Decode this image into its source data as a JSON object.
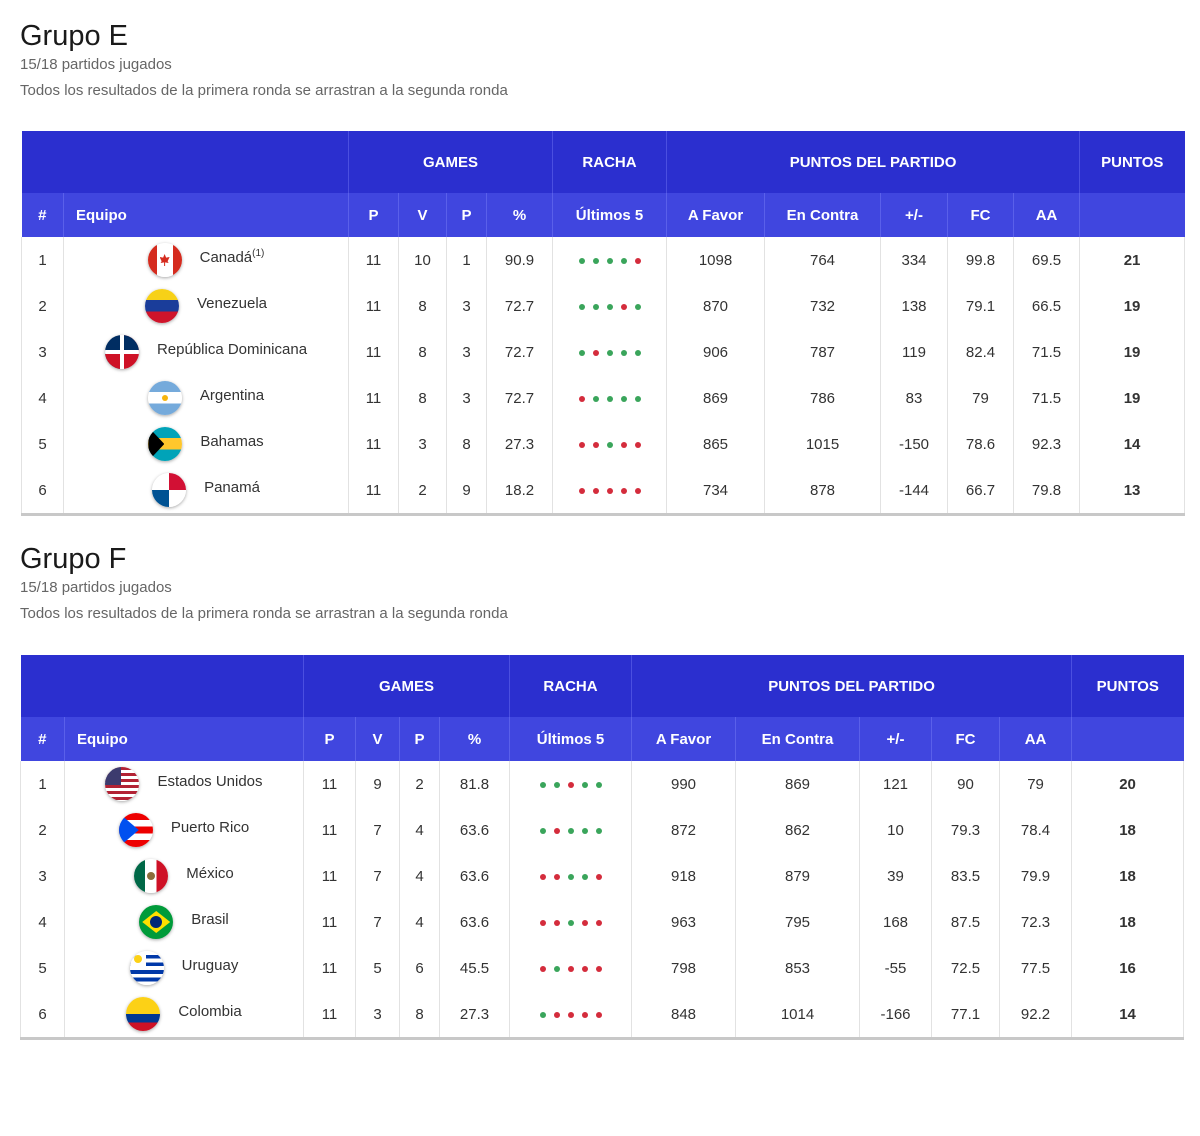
{
  "groups": [
    {
      "title": "Grupo E",
      "played": "15/18 partidos jugados",
      "note": "Todos los resultados de la primera ronda se arrastran a la segunda ronda",
      "header": {
        "games": "GAMES",
        "racha": "RACHA",
        "puntos_partido": "PUNTOS DEL PARTIDO",
        "puntos": "PUNTOS",
        "num": "#",
        "equipo": "Equipo",
        "p": "P",
        "v": "V",
        "p2": "P",
        "pct": "%",
        "ultimos": "Últimos 5",
        "afavor": "A Favor",
        "encontra": "En Contra",
        "diff": "+/-",
        "fc": "FC",
        "aa": "AA"
      },
      "rows": [
        {
          "pos": "1",
          "team": "Canadá",
          "sup": "(1)",
          "flag": "canada-flag",
          "p": "11",
          "v": "10",
          "l": "1",
          "pct": "90.9",
          "streak": [
            "W",
            "W",
            "W",
            "W",
            "L"
          ],
          "af": "1098",
          "ec": "764",
          "diff": "334",
          "fc": "99.8",
          "aa": "69.5",
          "pts": "21"
        },
        {
          "pos": "2",
          "team": "Venezuela",
          "sup": "",
          "flag": "venezuela-flag",
          "p": "11",
          "v": "8",
          "l": "3",
          "pct": "72.7",
          "streak": [
            "W",
            "W",
            "W",
            "L",
            "W"
          ],
          "af": "870",
          "ec": "732",
          "diff": "138",
          "fc": "79.1",
          "aa": "66.5",
          "pts": "19"
        },
        {
          "pos": "3",
          "team": "República Dominicana",
          "sup": "",
          "flag": "dominican-republic-flag",
          "p": "11",
          "v": "8",
          "l": "3",
          "pct": "72.7",
          "streak": [
            "W",
            "L",
            "W",
            "W",
            "W"
          ],
          "af": "906",
          "ec": "787",
          "diff": "119",
          "fc": "82.4",
          "aa": "71.5",
          "pts": "19"
        },
        {
          "pos": "4",
          "team": "Argentina",
          "sup": "",
          "flag": "argentina-flag",
          "p": "11",
          "v": "8",
          "l": "3",
          "pct": "72.7",
          "streak": [
            "L",
            "W",
            "W",
            "W",
            "W"
          ],
          "af": "869",
          "ec": "786",
          "diff": "83",
          "fc": "79",
          "aa": "71.5",
          "pts": "19"
        },
        {
          "pos": "5",
          "team": "Bahamas",
          "sup": "",
          "flag": "bahamas-flag",
          "p": "11",
          "v": "3",
          "l": "8",
          "pct": "27.3",
          "streak": [
            "L",
            "L",
            "W",
            "L",
            "L"
          ],
          "af": "865",
          "ec": "1015",
          "diff": "-150",
          "fc": "78.6",
          "aa": "92.3",
          "pts": "14"
        },
        {
          "pos": "6",
          "team": "Panamá",
          "sup": "",
          "flag": "panama-flag",
          "p": "11",
          "v": "2",
          "l": "9",
          "pct": "18.2",
          "streak": [
            "L",
            "L",
            "L",
            "L",
            "L"
          ],
          "af": "734",
          "ec": "878",
          "diff": "-144",
          "fc": "66.7",
          "aa": "79.8",
          "pts": "13"
        }
      ]
    },
    {
      "title": "Grupo F",
      "played": "15/18 partidos jugados",
      "note": "Todos los resultados de la primera ronda se arrastran a la segunda ronda",
      "header": {
        "games": "GAMES",
        "racha": "RACHA",
        "puntos_partido": "PUNTOS DEL PARTIDO",
        "puntos": "PUNTOS",
        "num": "#",
        "equipo": "Equipo",
        "p": "P",
        "v": "V",
        "p2": "P",
        "pct": "%",
        "ultimos": "Últimos 5",
        "afavor": "A Favor",
        "encontra": "En Contra",
        "diff": "+/-",
        "fc": "FC",
        "aa": "AA"
      },
      "rows": [
        {
          "pos": "1",
          "team": "Estados Unidos",
          "sup": "",
          "flag": "usa-flag",
          "p": "11",
          "v": "9",
          "l": "2",
          "pct": "81.8",
          "streak": [
            "W",
            "W",
            "L",
            "W",
            "W"
          ],
          "af": "990",
          "ec": "869",
          "diff": "121",
          "fc": "90",
          "aa": "79",
          "pts": "20"
        },
        {
          "pos": "2",
          "team": "Puerto Rico",
          "sup": "",
          "flag": "puerto-rico-flag",
          "p": "11",
          "v": "7",
          "l": "4",
          "pct": "63.6",
          "streak": [
            "W",
            "L",
            "W",
            "W",
            "W"
          ],
          "af": "872",
          "ec": "862",
          "diff": "10",
          "fc": "79.3",
          "aa": "78.4",
          "pts": "18"
        },
        {
          "pos": "3",
          "team": "México",
          "sup": "",
          "flag": "mexico-flag",
          "p": "11",
          "v": "7",
          "l": "4",
          "pct": "63.6",
          "streak": [
            "L",
            "L",
            "W",
            "W",
            "L"
          ],
          "af": "918",
          "ec": "879",
          "diff": "39",
          "fc": "83.5",
          "aa": "79.9",
          "pts": "18"
        },
        {
          "pos": "4",
          "team": "Brasil",
          "sup": "",
          "flag": "brazil-flag",
          "p": "11",
          "v": "7",
          "l": "4",
          "pct": "63.6",
          "streak": [
            "L",
            "L",
            "W",
            "L",
            "L"
          ],
          "af": "963",
          "ec": "795",
          "diff": "168",
          "fc": "87.5",
          "aa": "72.3",
          "pts": "18"
        },
        {
          "pos": "5",
          "team": "Uruguay",
          "sup": "",
          "flag": "uruguay-flag",
          "p": "11",
          "v": "5",
          "l": "6",
          "pct": "45.5",
          "streak": [
            "L",
            "W",
            "L",
            "L",
            "L"
          ],
          "af": "798",
          "ec": "853",
          "diff": "-55",
          "fc": "72.5",
          "aa": "77.5",
          "pts": "16"
        },
        {
          "pos": "6",
          "team": "Colombia",
          "sup": "",
          "flag": "colombia-flag",
          "p": "11",
          "v": "3",
          "l": "8",
          "pct": "27.3",
          "streak": [
            "W",
            "L",
            "L",
            "L",
            "L"
          ],
          "af": "848",
          "ec": "1014",
          "diff": "-166",
          "fc": "77.1",
          "aa": "92.2",
          "pts": "14"
        }
      ]
    }
  ],
  "colors": {
    "header_dark": "#2b2fcf",
    "header_light": "#4046df",
    "win": "#3aa55b",
    "loss": "#d42c3c"
  }
}
